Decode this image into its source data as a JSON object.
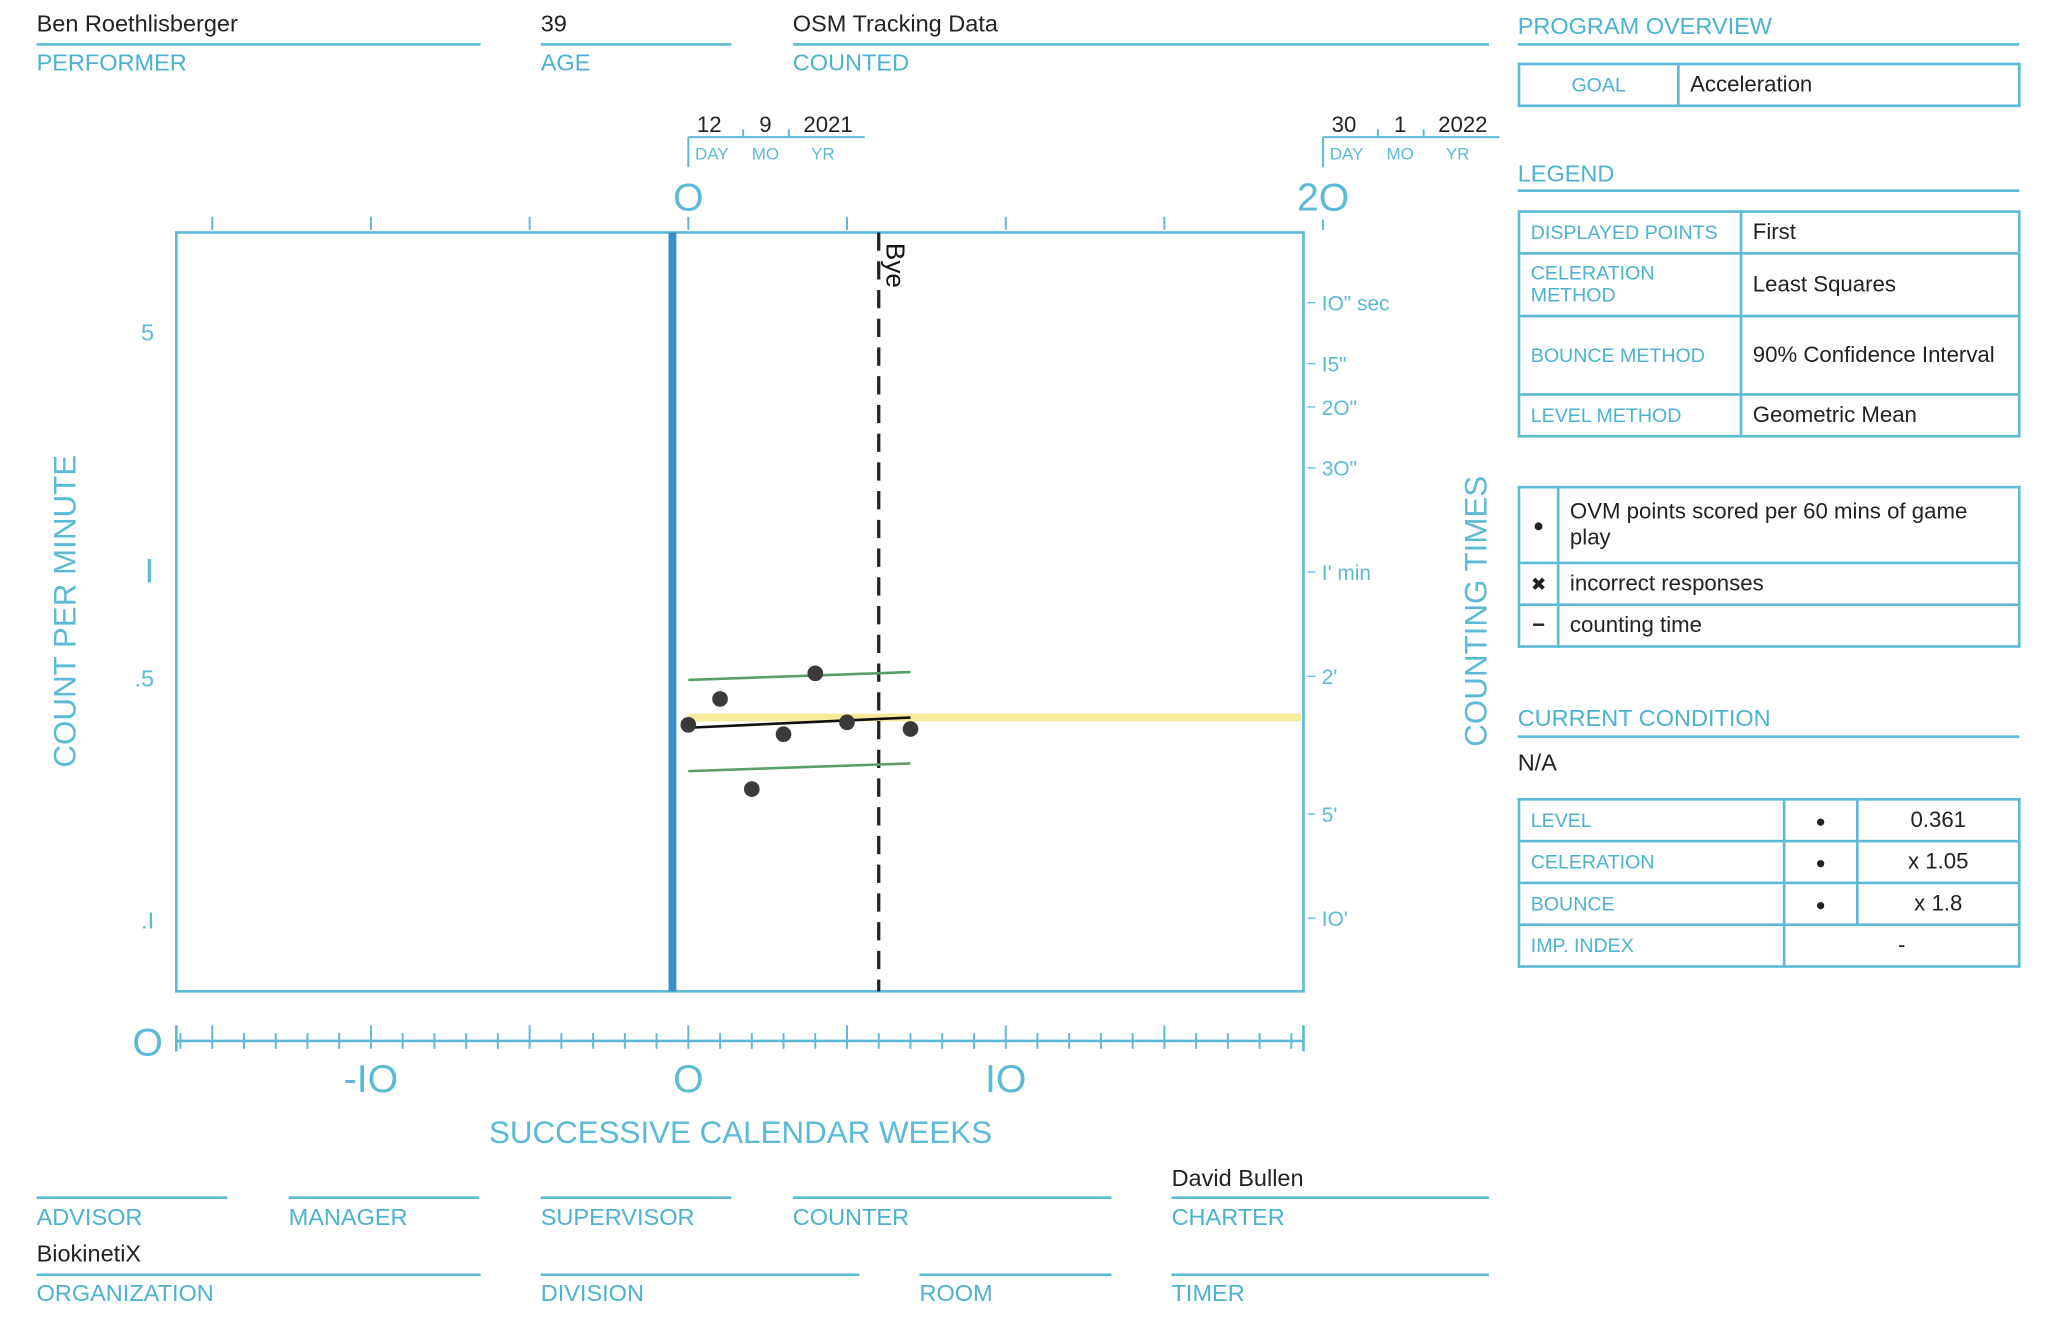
{
  "header": {
    "performer": {
      "value": "Ben Roethlisberger",
      "label": "PERFORMER"
    },
    "age": {
      "value": "39",
      "label": "AGE"
    },
    "counted": {
      "value": "OSM Tracking Data",
      "label": "COUNTED"
    }
  },
  "footer": {
    "advisor": {
      "value": "",
      "label": "ADVISOR"
    },
    "manager": {
      "value": "",
      "label": "MANAGER"
    },
    "supervisor": {
      "value": "",
      "label": "SUPERVISOR"
    },
    "counter": {
      "value": "",
      "label": "COUNTER"
    },
    "charter": {
      "value": "David Bullen",
      "label": "CHARTER"
    },
    "organization": {
      "value": "BiokinetiX",
      "label": "ORGANIZATION"
    },
    "division": {
      "value": "",
      "label": "DIVISION"
    },
    "room": {
      "value": "",
      "label": "ROOM"
    },
    "timer": {
      "value": "",
      "label": "TIMER"
    }
  },
  "program_overview": {
    "title": "PROGRAM OVERVIEW",
    "goal_label": "GOAL",
    "goal_value": "Acceleration"
  },
  "legend": {
    "title": "LEGEND",
    "rows": [
      {
        "key": "DISPLAYED POINTS",
        "value": "First"
      },
      {
        "key": "CELERATION METHOD",
        "value": "Least Squares"
      },
      {
        "key": "BOUNCE METHOD",
        "value": "90% Confidence Interval"
      },
      {
        "key": "LEVEL METHOD",
        "value": "Geometric Mean"
      }
    ],
    "symbols": [
      {
        "icon": "filled-dot",
        "glyph": "●",
        "text": "OVM points scored per 60 mins of game play"
      },
      {
        "icon": "x-mark",
        "glyph": "✖",
        "text": "incorrect responses"
      },
      {
        "icon": "dash",
        "glyph": "−",
        "text": "counting time"
      }
    ]
  },
  "current_condition": {
    "title": "CURRENT CONDITION",
    "status": "N/A",
    "rows": [
      {
        "key": "LEVEL",
        "glyph": "●",
        "value": "0.361"
      },
      {
        "key": "CELERATION",
        "glyph": "●",
        "value": "x 1.05"
      },
      {
        "key": "BOUNCE",
        "glyph": "●",
        "value": "x 1.8"
      },
      {
        "key": "IMP. INDEX",
        "glyph": "",
        "value": "-"
      }
    ]
  },
  "chart_data": {
    "type": "scatter",
    "y_scale": "log",
    "ylabel": "COUNT PER MINUTE",
    "ylabel_right": "COUNTING TIMES",
    "xlabel": "SUCCESSIVE CALENDAR WEEKS",
    "xlim": [
      -16,
      19.5
    ],
    "ylim": [
      0.061,
      9.6
    ],
    "y_ticks": [
      {
        "value": 5,
        "label": "5"
      },
      {
        "value": 1,
        "label": "I"
      },
      {
        "value": 0.5,
        "label": ".5"
      },
      {
        "value": 0.1,
        "label": ".I"
      }
    ],
    "x_ticks": [
      {
        "value": -10,
        "label": "-IO"
      },
      {
        "value": 0,
        "label": "O"
      },
      {
        "value": 10,
        "label": "IO"
      }
    ],
    "x_origin_label": "O",
    "top_ticks": [
      {
        "value": 0,
        "label": "O"
      },
      {
        "value": 20,
        "label": "2O"
      }
    ],
    "dates": [
      {
        "week": 0,
        "day": "12",
        "month": "9",
        "year": "2021"
      },
      {
        "week": 20,
        "day": "30",
        "month": "1",
        "year": "2022"
      }
    ],
    "date_labels": {
      "day": "DAY",
      "month": "MO",
      "year": "YR"
    },
    "counting_times": [
      {
        "per_minute": 6,
        "label": "IO\" sec"
      },
      {
        "per_minute": 4,
        "label": "I5\""
      },
      {
        "per_minute": 3,
        "label": "2O\""
      },
      {
        "per_minute": 2,
        "label": "3O\""
      },
      {
        "per_minute": 1,
        "label": "I' min"
      },
      {
        "per_minute": 0.5,
        "label": "2'"
      },
      {
        "per_minute": 0.2,
        "label": "5'"
      },
      {
        "per_minute": 0.1,
        "label": "IO'"
      }
    ],
    "phase_line_week": -0.5,
    "event": {
      "week": 6,
      "label": "Bye"
    },
    "points": [
      {
        "x": 0,
        "y": 0.362
      },
      {
        "x": 1,
        "y": 0.43
      },
      {
        "x": 2,
        "y": 0.236
      },
      {
        "x": 3,
        "y": 0.34
      },
      {
        "x": 4,
        "y": 0.51
      },
      {
        "x": 5,
        "y": 0.368
      },
      {
        "x": 7,
        "y": 0.352
      }
    ],
    "level_line": {
      "y": 0.38,
      "from": 0,
      "to": 19.5
    },
    "celeration_line": {
      "x": [
        0,
        7
      ],
      "y": [
        0.355,
        0.38
      ]
    },
    "bounce_upper": {
      "x": [
        0,
        7
      ],
      "y": [
        0.488,
        0.514
      ]
    },
    "bounce_lower": {
      "x": [
        0,
        7
      ],
      "y": [
        0.266,
        0.28
      ]
    },
    "colors": {
      "axis": "#5bbad6",
      "phase": "#3a8fc8",
      "level": "#f5eb9a",
      "bounce": "#5a9e6a",
      "point": "#3a3a3a"
    }
  }
}
